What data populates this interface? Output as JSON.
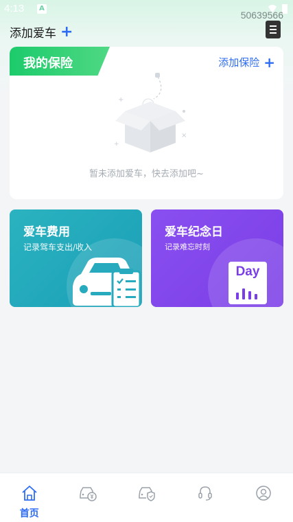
{
  "status_bar": {
    "time": "4:13",
    "indicator": "A"
  },
  "device_id": "50639566",
  "header": {
    "title": "添加爱车",
    "add_icon": "plus-icon",
    "doc_icon": "document-icon"
  },
  "insurance_card": {
    "tag": "我的保险",
    "add_label": "添加保险",
    "empty_text": "暂未添加爱车，快去添加吧~"
  },
  "features": [
    {
      "title": "爱车费用",
      "subtitle": "记录驾车支出/收入",
      "icon": "car-clipboard-icon"
    },
    {
      "title": "爱车纪念日",
      "subtitle": "记录难忘时刻",
      "icon": "day-calendar-icon",
      "badge": "Day"
    }
  ],
  "tabs": [
    {
      "label": "首页",
      "icon": "home-icon",
      "active": true
    },
    {
      "label": "",
      "icon": "car-money-icon",
      "active": false
    },
    {
      "label": "",
      "icon": "car-shield-icon",
      "active": false
    },
    {
      "label": "",
      "icon": "headset-icon",
      "active": false
    },
    {
      "label": "",
      "icon": "user-icon",
      "active": false
    }
  ],
  "colors": {
    "accent": "#2d6cf2",
    "insurance_tag": "#1ccb6b",
    "expense_card": "#1fa7ba",
    "anniversary_card": "#7f44ea",
    "inactive_icon": "#9aa1a9"
  }
}
